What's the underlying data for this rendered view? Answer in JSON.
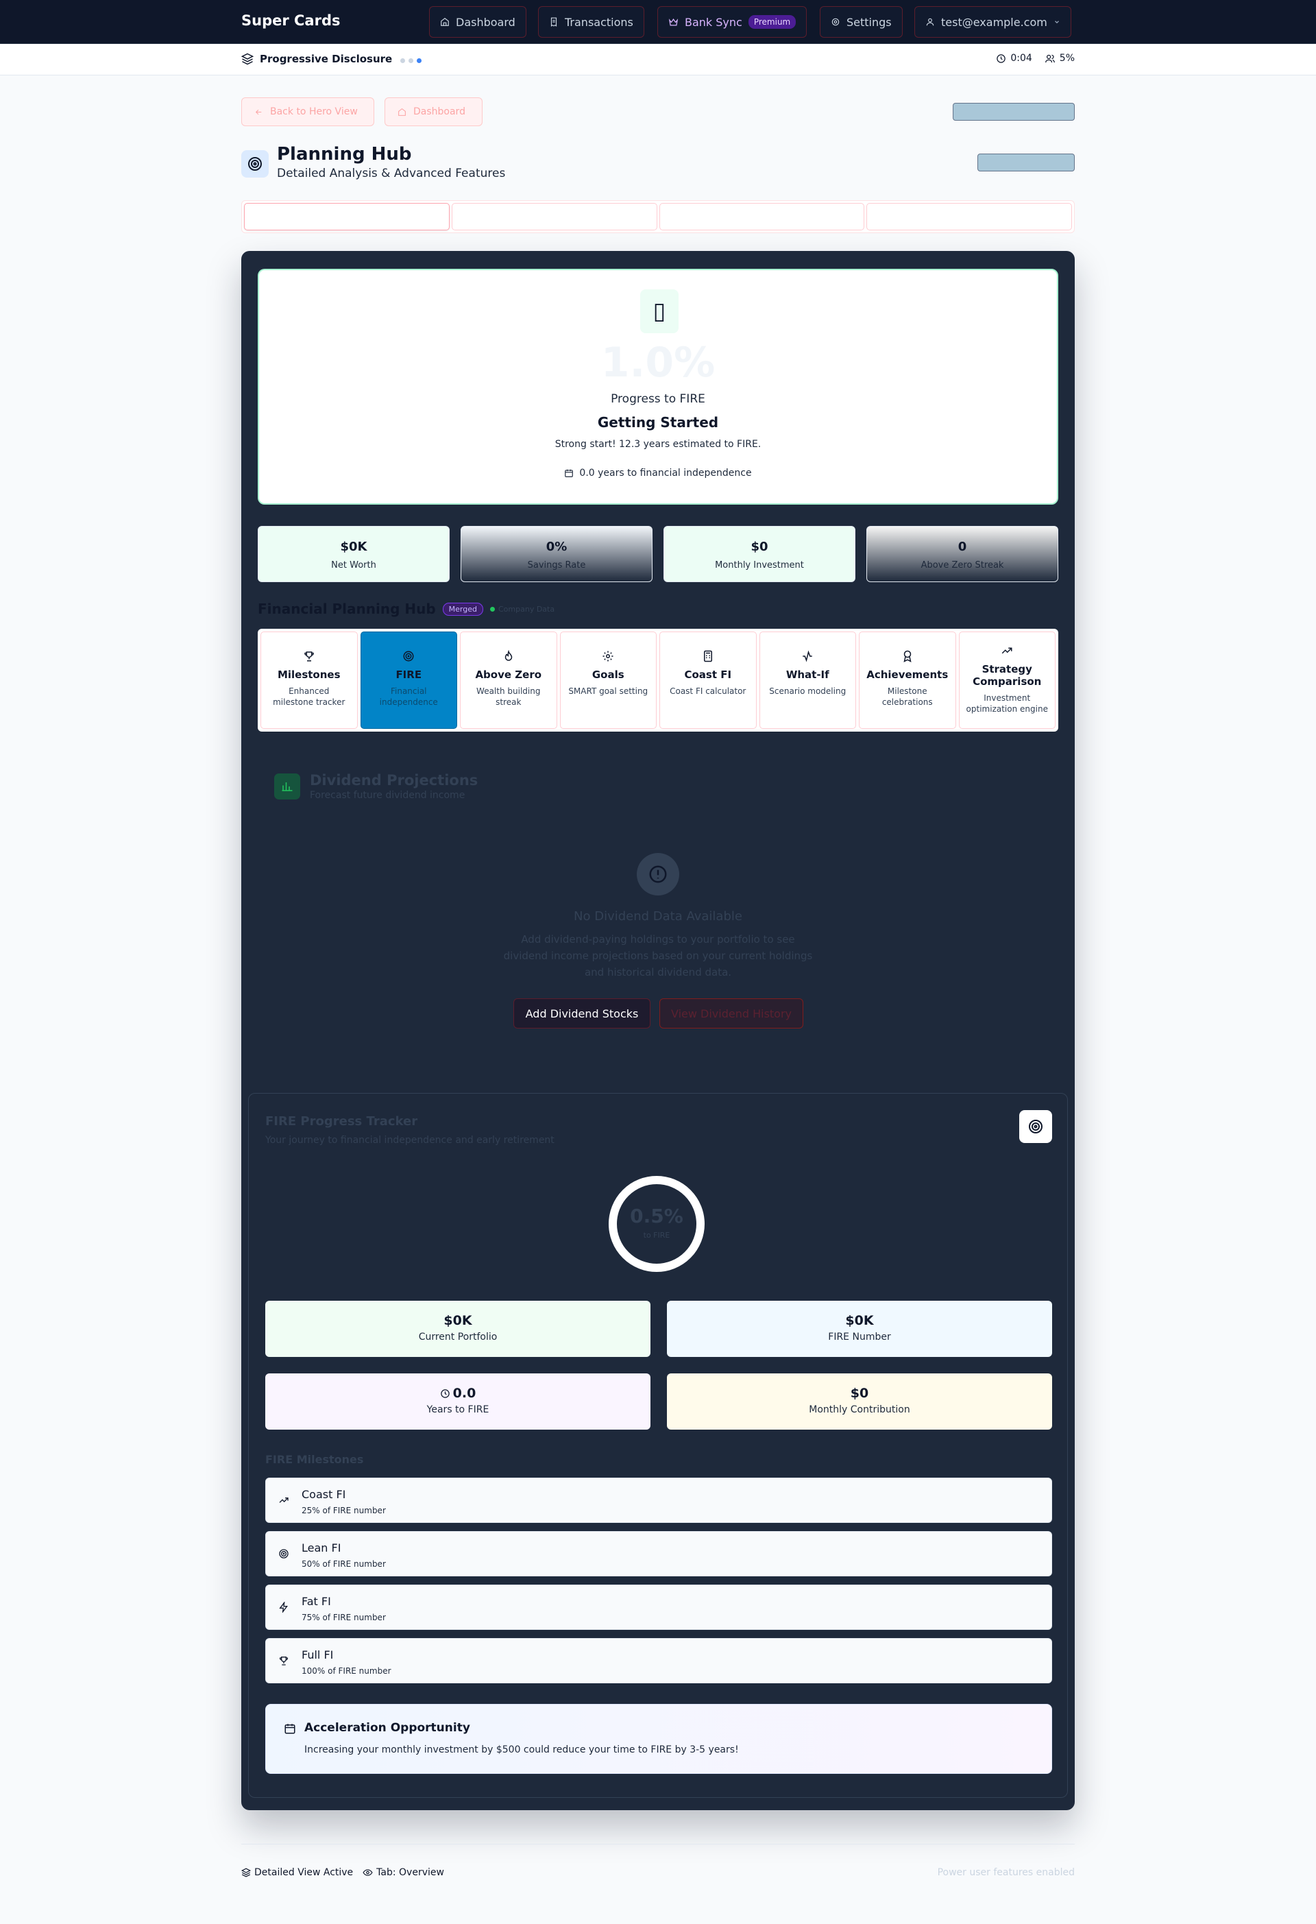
{
  "nav": {
    "brand": "Super Cards",
    "items": [
      {
        "label": "Dashboard",
        "icon": "home-icon"
      },
      {
        "label": "Transactions",
        "icon": "receipt-icon"
      },
      {
        "label": "Bank Sync",
        "icon": "crown-icon",
        "badge": "Premium"
      },
      {
        "label": "Settings",
        "icon": "gear-icon"
      }
    ],
    "user": "test@example.com"
  },
  "subbar": {
    "title": "Progressive Disclosure",
    "timer": "0:04",
    "percent": "5%"
  },
  "actions": {
    "back": "Back to Hero View",
    "dashboard": "Dashboard"
  },
  "hub": {
    "title": "Planning Hub",
    "subtitle": "Detailed Analysis & Advanced Features"
  },
  "hero": {
    "icon": "target-icon",
    "percent": "1.0%",
    "label": "Progress to FIRE",
    "status": "Getting Started",
    "message": "Strong start! 12.3 years estimated to FIRE.",
    "years": "0.0 years to financial independence"
  },
  "stats": [
    {
      "value": "$0K",
      "label": "Net Worth"
    },
    {
      "value": "0%",
      "label": "Savings Rate"
    },
    {
      "value": "$0",
      "label": "Monthly Investment"
    },
    {
      "value": "0",
      "label": "Above Zero Streak"
    }
  ],
  "planning": {
    "title": "Financial Planning Hub",
    "badge": "Merged",
    "live_label": "Company Data",
    "cards": [
      {
        "name": "Milestones",
        "desc": "Enhanced milestone tracker",
        "icon": "trophy-icon"
      },
      {
        "name": "FIRE",
        "desc": "Financial independence",
        "icon": "target-icon",
        "active": true
      },
      {
        "name": "Above Zero",
        "desc": "Wealth building streak",
        "icon": "flame-icon"
      },
      {
        "name": "Goals",
        "desc": "SMART goal setting",
        "icon": "gear-icon"
      },
      {
        "name": "Coast FI",
        "desc": "Coast FI calculator",
        "icon": "calculator-icon"
      },
      {
        "name": "What-If",
        "desc": "Scenario modeling",
        "icon": "activity-icon"
      },
      {
        "name": "Achievements",
        "desc": "Milestone celebrations",
        "icon": "award-icon"
      },
      {
        "name": "Strategy Comparison",
        "desc": "Investment optimization engine",
        "icon": "trending-up-icon"
      }
    ]
  },
  "dividend": {
    "title": "Dividend Projections",
    "subtitle": "Forecast future dividend income",
    "empty_title": "No Dividend Data Available",
    "empty_desc": "Add dividend-paying holdings to your portfolio to see dividend income projections based on your current holdings and historical dividend data.",
    "add_button": "Add Dividend Stocks",
    "history_button": "View Dividend History"
  },
  "fire": {
    "title": "FIRE Progress Tracker",
    "subtitle": "Your journey to financial independence and early retirement",
    "progress": "0.5%",
    "progress_label": "to FIRE",
    "stats": [
      {
        "value": "$0K",
        "label": "Current Portfolio",
        "color": "#f0fdf4"
      },
      {
        "value": "$0K",
        "label": "FIRE Number",
        "color": "#f0f9ff"
      },
      {
        "value": "0.0",
        "label": "Years to FIRE",
        "color": "#faf5ff"
      },
      {
        "value": "$0",
        "label": "Monthly Contribution",
        "color": "#fffbeb"
      }
    ],
    "milestones_title": "FIRE Milestones",
    "milestones": [
      {
        "name": "Coast FI",
        "desc": "25% of FIRE number",
        "icon": "trending-up-icon"
      },
      {
        "name": "Lean FI",
        "desc": "50% of FIRE number",
        "icon": "target-icon"
      },
      {
        "name": "Fat FI",
        "desc": "75% of FIRE number",
        "icon": "zap-icon"
      },
      {
        "name": "Full FI",
        "desc": "100% of FIRE number",
        "icon": "trophy-icon"
      }
    ],
    "accel_title": "Acceleration Opportunity",
    "accel_desc": "Increasing your monthly investment by $500 could reduce your time to FIRE by 3-5 years!"
  },
  "footer": {
    "view": "Detailed View Active",
    "tab": "Tab: Overview",
    "right": "Power user features enabled"
  }
}
